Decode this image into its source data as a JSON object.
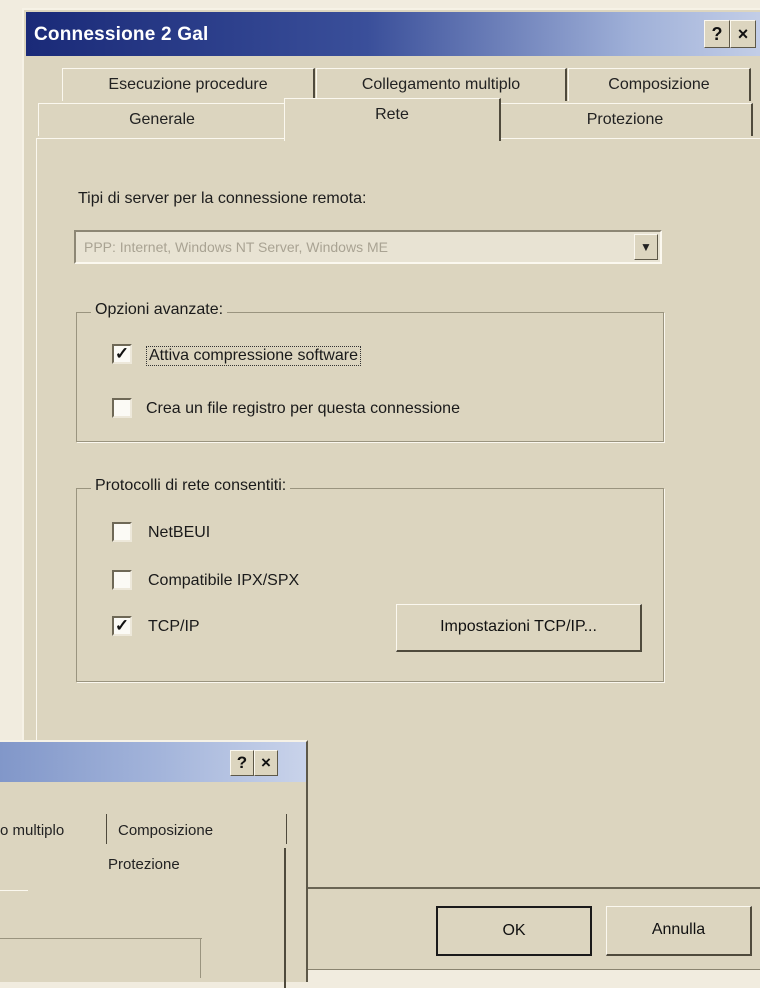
{
  "window": {
    "title": "Connessione 2 Gal",
    "help_button": "?",
    "close_button": "×"
  },
  "tabs": {
    "row1": [
      "Esecuzione procedure",
      "Collegamento multiplo",
      "Composizione"
    ],
    "row2": [
      "Generale",
      "Rete",
      "Protezione"
    ],
    "active": "Rete"
  },
  "server": {
    "label": "Tipi di server per la connessione remota:",
    "value": "PPP: Internet, Windows NT Server, Windows ME"
  },
  "advanced": {
    "title": "Opzioni avanzate:",
    "compression_label": "Attiva compressione software",
    "compression_checked": true,
    "log_label": "Crea un file registro per questa connessione",
    "log_checked": false
  },
  "protocols": {
    "title": "Protocolli di rete consentiti:",
    "netbeui_label": "NetBEUI",
    "netbeui_checked": false,
    "ipx_label": "Compatibile IPX/SPX",
    "ipx_checked": false,
    "tcpip_label": "TCP/IP",
    "tcpip_checked": true,
    "tcpip_settings_button": "Impostazioni TCP/IP..."
  },
  "buttons": {
    "ok": "OK",
    "cancel": "Annulla"
  },
  "check_glyph": "✓",
  "second_window": {
    "help_button": "?",
    "close_button": "×",
    "tab_partial": "o multiplo",
    "tab_composizione": "Composizione",
    "tab_protezione": "Protezione"
  }
}
